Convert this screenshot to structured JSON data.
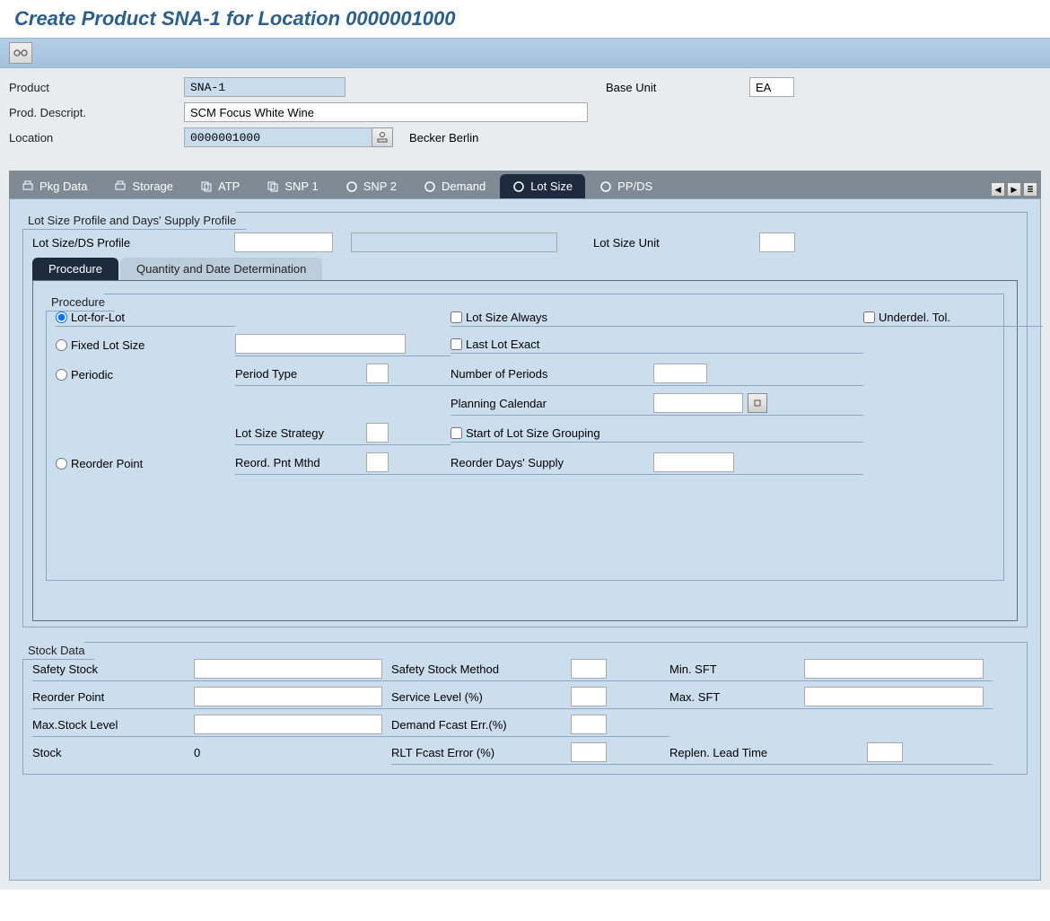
{
  "title": "Create Product SNA-1 for Location 0000001000",
  "header": {
    "product_label": "Product",
    "product_value": "SNA-1",
    "baseunit_label": "Base Unit",
    "baseunit_value": "EA",
    "descript_label": "Prod. Descript.",
    "descript_value": "SCM Focus White Wine",
    "location_label": "Location",
    "location_value": "0000001000",
    "location_text": "Becker Berlin"
  },
  "tabs": {
    "pkg": "Pkg Data",
    "storage": "Storage",
    "atp": "ATP",
    "snp1": "SNP 1",
    "snp2": "SNP 2",
    "demand": "Demand",
    "lotsize": "Lot Size",
    "ppds": "PP/DS"
  },
  "lotsize": {
    "group_title": "Lot Size Profile and Days' Supply Profile",
    "profile_label": "Lot Size/DS Profile",
    "unit_label": "Lot Size Unit",
    "subtabs": {
      "procedure": "Procedure",
      "qtydate": "Quantity and Date Determination"
    },
    "proc": {
      "group_title": "Procedure",
      "lotforlot": "Lot-for-Lot",
      "fixed": "Fixed Lot Size",
      "periodic": "Periodic",
      "reorder": "Reorder Point",
      "lotsize_always": "Lot Size Always",
      "underdel": "Underdel. Tol.",
      "lastlot": "Last Lot Exact",
      "periodtype": "Period Type",
      "numperiods": "Number of Periods",
      "plancal": "Planning Calendar",
      "lotstrategy": "Lot Size Strategy",
      "startgroup": "Start of Lot Size Grouping",
      "reord_method": "Reord. Pnt Mthd",
      "reord_days": "Reorder Days' Supply"
    },
    "stock": {
      "group_title": "Stock Data",
      "safety_stock": "Safety Stock",
      "reorder_point": "Reorder Point",
      "max_stock": "Max.Stock Level",
      "stock_label": "Stock",
      "stock_value": "0",
      "ss_method": "Safety Stock Method",
      "service_level": "Service Level (%)",
      "demand_fcast": "Demand Fcast Err.(%)",
      "rlt_fcast": "RLT Fcast Error (%)",
      "min_sft": "Min. SFT",
      "max_sft": "Max. SFT",
      "replen": "Replen. Lead Time"
    }
  }
}
